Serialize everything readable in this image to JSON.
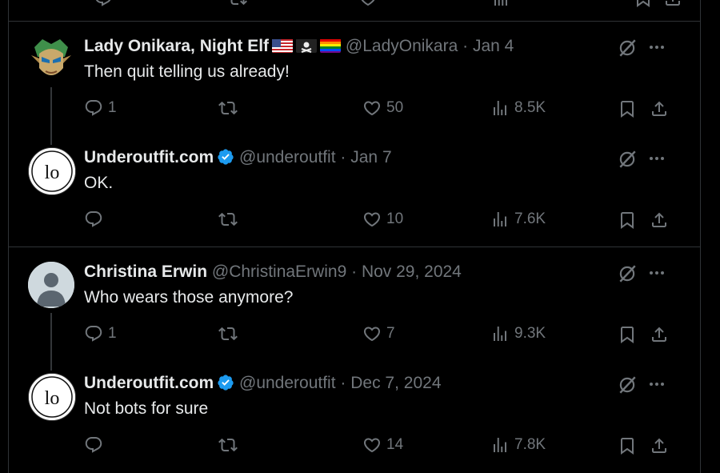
{
  "tweets": [
    {
      "name": "Lady Onikara, Night Elf",
      "flags": [
        "us-flag",
        "pirate-flag",
        "rainbow-flag"
      ],
      "handle": "@LadyOnikara",
      "date": "Jan 4",
      "text": "Then quit telling us already!",
      "replies": "1",
      "reposts": "",
      "likes": "50",
      "views": "8.5K",
      "avatar": "mask-avatar"
    },
    {
      "name": "Underoutfit.com",
      "verified": true,
      "handle": "@underoutfit",
      "date": "Jan 7",
      "text": "OK.",
      "replies": "",
      "reposts": "",
      "likes": "10",
      "views": "7.6K",
      "avatar": "underoutfit-logo"
    },
    {
      "name": "Christina Erwin",
      "handle": "@ChristinaErwin9",
      "date": "Nov 29, 2024",
      "text": "Who wears those anymore?",
      "replies": "1",
      "reposts": "",
      "likes": "7",
      "views": "9.3K",
      "avatar": "default-avatar"
    },
    {
      "name": "Underoutfit.com",
      "verified": true,
      "handle": "@underoutfit",
      "date": "Dec 7, 2024",
      "text": "Not bots for sure",
      "replies": "",
      "reposts": "",
      "likes": "14",
      "views": "7.8K",
      "avatar": "underoutfit-logo"
    }
  ],
  "separator": "·",
  "colors": {
    "background": "#000000",
    "text": "#e7e9ea",
    "muted": "#71767b",
    "border": "#2f3336",
    "verified": "#1d9bf0"
  }
}
